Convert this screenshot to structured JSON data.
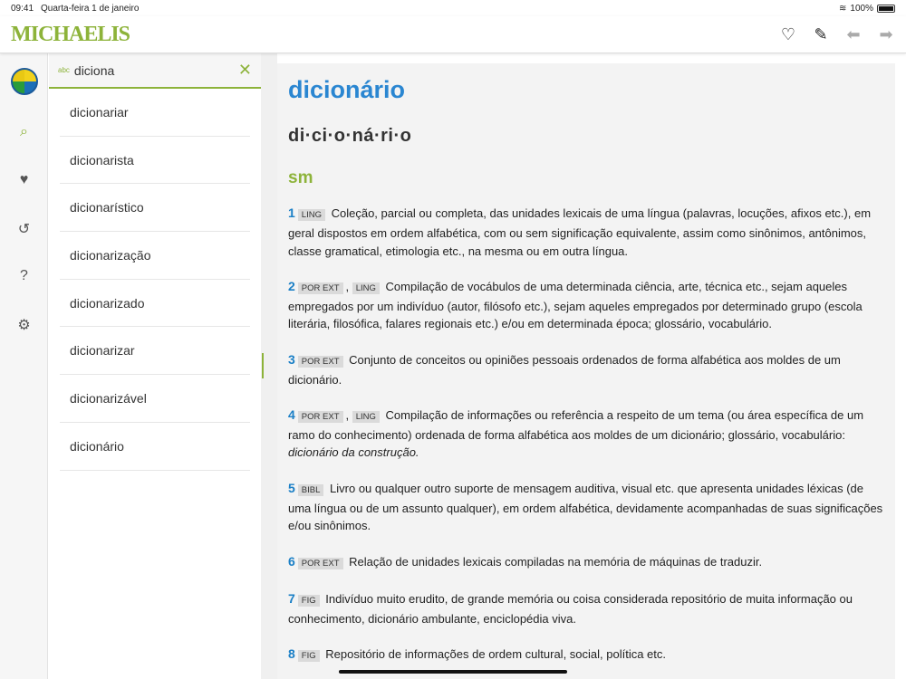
{
  "status": {
    "time": "09:41",
    "date": "Quarta-feira 1 de janeiro",
    "battery": "100%"
  },
  "header": {
    "logo": "MICHAELIS",
    "icons": [
      "heart-outline-icon",
      "pencil-icon",
      "arrow-back-icon",
      "arrow-forward-icon"
    ]
  },
  "rail": {
    "icons": [
      "search-icon",
      "heart-icon",
      "history-icon",
      "help-icon",
      "settings-icon"
    ]
  },
  "search": {
    "hint": "abc",
    "value": "diciona"
  },
  "suggestions": [
    "dicionariar",
    "dicionarista",
    "dicionarístico",
    "dicionarização",
    "dicionarizado",
    "dicionarizar",
    "dicionarizável",
    "dicionário"
  ],
  "entry": {
    "headword": "dicionário",
    "syllables": "di·ci·o·ná·ri·o",
    "class": "sm",
    "defs": [
      {
        "n": "1",
        "tags": [
          "LING"
        ],
        "text": "Coleção, parcial ou completa, das unidades lexicais de uma língua (palavras, locuções, afixos etc.), em geral dispostos em ordem alfabética, com ou sem significação equivalente, assim como sinônimos, antônimos, classe gramatical, etimologia etc., na mesma ou em outra língua."
      },
      {
        "n": "2",
        "tags": [
          "POR EXT",
          "LING"
        ],
        "text": "Compilação de vocábulos de uma determinada ciência, arte, técnica etc., sejam aqueles empregados por um indivíduo (autor, filósofo etc.), sejam aqueles empregados por determinado grupo (escola literária, filosófica, falares regionais etc.) e/ou em determinada época; glossário, vocabulário."
      },
      {
        "n": "3",
        "tags": [
          "POR EXT"
        ],
        "text": "Conjunto de conceitos ou opiniões pessoais ordenados de forma alfabética aos moldes de um dicionário."
      },
      {
        "n": "4",
        "tags": [
          "POR EXT",
          "LING"
        ],
        "text": "Compilação de informações ou referência a respeito de um tema (ou área específica de um ramo do conhecimento) ordenada de forma alfabética aos moldes de um dicionário; glossário, vocabulário:",
        "example": "dicionário da construção."
      },
      {
        "n": "5",
        "tags": [
          "BIBL"
        ],
        "text": "Livro ou qualquer outro suporte de mensagem auditiva, visual etc. que apresenta unidades léxicas (de uma língua ou de um assunto qualquer), em ordem alfabética, devidamente acompanhadas de suas significações e/ou sinônimos."
      },
      {
        "n": "6",
        "tags": [
          "POR EXT"
        ],
        "text": "Relação de unidades lexicais compiladas na memória de máquinas de traduzir."
      },
      {
        "n": "7",
        "tags": [
          "FIG"
        ],
        "text": "Indivíduo muito erudito, de grande memória ou coisa considerada repositório de muita informação ou conhecimento, dicionário ambulante, enciclopédia viva."
      },
      {
        "n": "8",
        "tags": [
          "FIG"
        ],
        "text": "Repositório de informações de ordem cultural, social, política etc."
      }
    ]
  }
}
